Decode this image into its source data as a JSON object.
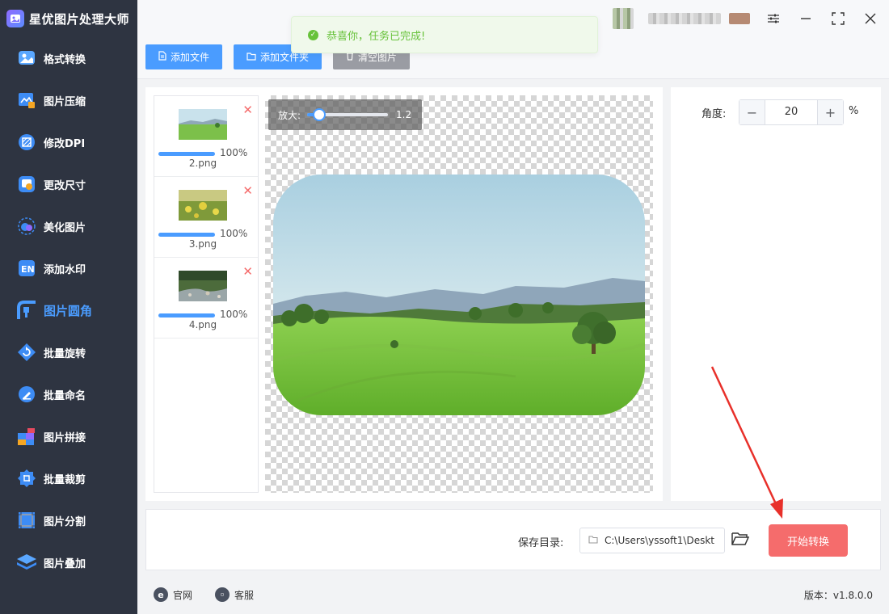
{
  "app": {
    "title": "星优图片处理大师"
  },
  "sidebar": {
    "items": [
      {
        "label": "格式转换",
        "icon": "image-convert-icon"
      },
      {
        "label": "图片压缩",
        "icon": "image-compress-icon"
      },
      {
        "label": "修改DPI",
        "icon": "dpi-icon"
      },
      {
        "label": "更改尺寸",
        "icon": "resize-icon"
      },
      {
        "label": "美化图片",
        "icon": "beautify-icon"
      },
      {
        "label": "添加水印",
        "icon": "watermark-icon"
      },
      {
        "label": "图片圆角",
        "icon": "rounded-corner-icon",
        "active": true
      },
      {
        "label": "批量旋转",
        "icon": "rotate-icon"
      },
      {
        "label": "批量命名",
        "icon": "rename-icon"
      },
      {
        "label": "图片拼接",
        "icon": "stitch-icon"
      },
      {
        "label": "批量裁剪",
        "icon": "crop-icon"
      },
      {
        "label": "图片分割",
        "icon": "split-icon"
      },
      {
        "label": "图片叠加",
        "icon": "overlay-icon"
      }
    ]
  },
  "toolbar": {
    "add_file": "添加文件",
    "add_folder": "添加文件夹",
    "clear_images": "清空图片"
  },
  "toast": {
    "message": "恭喜你，任务已完成!"
  },
  "files": [
    {
      "name": "2.png",
      "progress": 100,
      "progress_text": "100%"
    },
    {
      "name": "3.png",
      "progress": 100,
      "progress_text": "100%"
    },
    {
      "name": "4.png",
      "progress": 100,
      "progress_text": "100%"
    }
  ],
  "zoom": {
    "label": "放大:",
    "value": "1.2"
  },
  "settings": {
    "angle_label": "角度:",
    "angle_value": "20",
    "unit": "%"
  },
  "save": {
    "label": "保存目录:",
    "path": "C:\\Users\\yssoft1\\Deskt",
    "start_label": "开始转换"
  },
  "footer": {
    "website": "官网",
    "support": "客服",
    "version": "版本：v1.8.0.0"
  },
  "colors": {
    "accent": "#4a9cff",
    "sidebar_bg": "#2e3441",
    "start_button": "#f56c6c",
    "toast_text": "#67c23a"
  }
}
